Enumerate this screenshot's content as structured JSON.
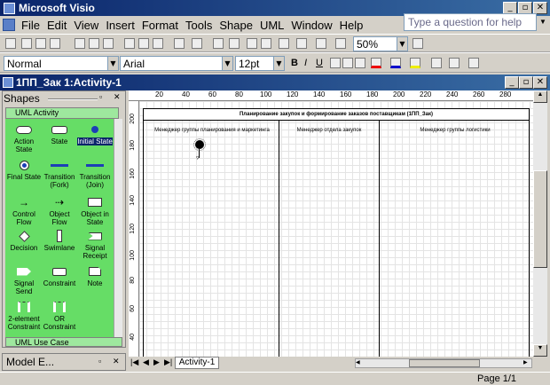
{
  "app": {
    "title": "Microsoft Visio"
  },
  "menu": [
    "File",
    "Edit",
    "View",
    "Insert",
    "Format",
    "Tools",
    "Shape",
    "UML",
    "Window",
    "Help"
  ],
  "help_box": {
    "placeholder": "Type a question for help"
  },
  "toolbar": {
    "zoom": "50%"
  },
  "format_bar": {
    "style": "Normal",
    "font": "Arial",
    "size": "12pt",
    "bold": "B",
    "italic": "I",
    "underline": "U"
  },
  "document": {
    "title": "1ПП_Зак 1:Activity-1"
  },
  "shapes_panel": {
    "title": "Shapes",
    "stencil": "UML Activity",
    "footer_stencil": "UML Use Case",
    "items": [
      {
        "label": "Action State",
        "icon": "action-state-icon"
      },
      {
        "label": "State",
        "icon": "state-icon"
      },
      {
        "label": "Initial State",
        "icon": "initial-state-icon"
      },
      {
        "label": "Final State",
        "icon": "final-state-icon"
      },
      {
        "label": "Transition (Fork)",
        "icon": "fork-icon"
      },
      {
        "label": "Transition (Join)",
        "icon": "join-icon"
      },
      {
        "label": "Control Flow",
        "icon": "control-flow-icon"
      },
      {
        "label": "Object Flow",
        "icon": "object-flow-icon"
      },
      {
        "label": "Object in State",
        "icon": "object-in-state-icon"
      },
      {
        "label": "Decision",
        "icon": "decision-icon"
      },
      {
        "label": "Swimlane",
        "icon": "swimlane-icon"
      },
      {
        "label": "Signal Receipt",
        "icon": "signal-receipt-icon"
      },
      {
        "label": "Signal Send",
        "icon": "signal-send-icon"
      },
      {
        "label": "Constraint",
        "icon": "constraint-icon"
      },
      {
        "label": "Note",
        "icon": "note-icon"
      },
      {
        "label": "2-element Constraint",
        "icon": "two-element-constraint-icon"
      },
      {
        "label": "OR Constraint",
        "icon": "or-constraint-icon"
      }
    ]
  },
  "model_explorer": {
    "title": "Model E..."
  },
  "diagram": {
    "header": "Планирование закупок и формирование заказов поставщикам (1ПП_Зак)",
    "lanes": [
      "Менеджер группы планирования и маркетинга",
      "Менеджер отдела закупок",
      "Менеджер группы логистики"
    ]
  },
  "rulers": {
    "h_ticks": [
      "20",
      "40",
      "60",
      "80",
      "100",
      "120",
      "140",
      "160",
      "180",
      "200",
      "220",
      "240",
      "260",
      "280"
    ],
    "v_ticks": [
      "200",
      "180",
      "160",
      "140",
      "120",
      "100",
      "80",
      "60",
      "40"
    ]
  },
  "page_tab": "Activity-1",
  "status": {
    "page": "Page 1/1"
  },
  "colors": {
    "stencil_bg": "#66dd66",
    "title_bar": "#0a246a"
  }
}
